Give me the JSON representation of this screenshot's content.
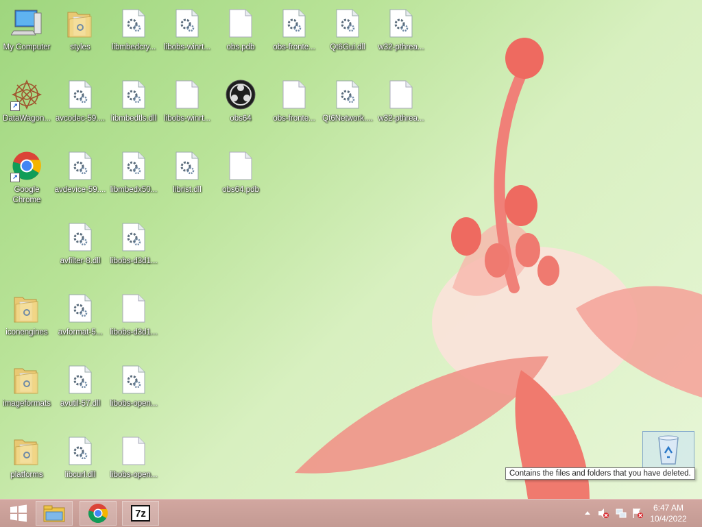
{
  "desktop": {
    "icons": [
      {
        "label": "My Computer",
        "type": "computer"
      },
      {
        "label": "styles",
        "type": "folder"
      },
      {
        "label": "libmbedcry...",
        "type": "dll"
      },
      {
        "label": "libobs-winrt...",
        "type": "dll"
      },
      {
        "label": "obs.pdb",
        "type": "file"
      },
      {
        "label": "obs-fronte...",
        "type": "dll"
      },
      {
        "label": "Qt6Gui.dll",
        "type": "dll"
      },
      {
        "label": "w32-pthrea...",
        "type": "dll"
      },
      {
        "label": "DataWagon...",
        "type": "datawagon"
      },
      {
        "label": "avcodec-59....",
        "type": "dll"
      },
      {
        "label": "libmbedtls.dll",
        "type": "dll"
      },
      {
        "label": "libobs-winrt...",
        "type": "file"
      },
      {
        "label": "obs64",
        "type": "obs"
      },
      {
        "label": "obs-fronte...",
        "type": "file"
      },
      {
        "label": "Qt6Network....",
        "type": "dll"
      },
      {
        "label": "w32-pthrea...",
        "type": "file"
      },
      {
        "label": "Google Chrome",
        "type": "chrome"
      },
      {
        "label": "avdevice-59....",
        "type": "dll"
      },
      {
        "label": "libmbedx50...",
        "type": "dll"
      },
      {
        "label": "librist.dll",
        "type": "dll"
      },
      {
        "label": "obs64.pdb",
        "type": "file"
      },
      {
        "label": "avfilter-8.dll",
        "type": "dll"
      },
      {
        "label": "libobs-d3d1...",
        "type": "dll"
      },
      {
        "label": "iconengines",
        "type": "folder"
      },
      {
        "label": "avformat-5...",
        "type": "dll"
      },
      {
        "label": "libobs-d3d1...",
        "type": "file"
      },
      {
        "label": "imageformats",
        "type": "folder"
      },
      {
        "label": "avutil-57.dll",
        "type": "dll"
      },
      {
        "label": "libobs-open...",
        "type": "dll"
      },
      {
        "label": "platforms",
        "type": "folder"
      },
      {
        "label": "libcurl.dll",
        "type": "dll"
      },
      {
        "label": "libobs-open...",
        "type": "file"
      }
    ]
  },
  "tooltip": {
    "text": "Contains the files and folders that you have deleted."
  },
  "taskbar": {
    "clock_time": "6:47 AM",
    "clock_date": "10/4/2022",
    "pinned": [
      {
        "name": "file-explorer-icon"
      },
      {
        "name": "chrome-icon"
      },
      {
        "name": "7zip-icon",
        "text": "7z"
      }
    ]
  },
  "colors": {
    "taskbar": "#c9a19a",
    "accent": "#1a55c8"
  }
}
